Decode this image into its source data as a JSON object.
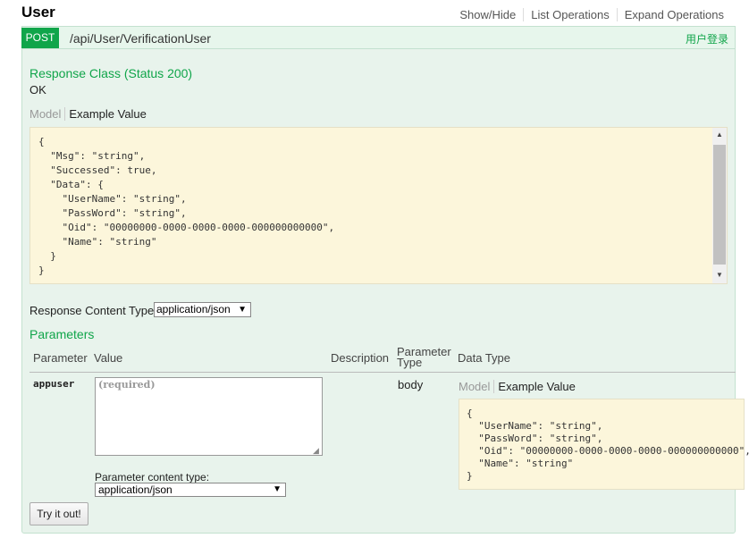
{
  "resource": {
    "title": "User",
    "links": [
      "Show/Hide",
      "List Operations",
      "Expand Operations"
    ]
  },
  "operation": {
    "method": "POST",
    "path": "/api/User/VerificationUser",
    "summary": "用户登录"
  },
  "response": {
    "class_title": "Response Class (Status 200)",
    "status_text": "OK",
    "tab_model": "Model",
    "tab_example": "Example Value",
    "example_json": "{\n  \"Msg\": \"string\",\n  \"Successed\": true,\n  \"Data\": {\n    \"UserName\": \"string\",\n    \"PassWord\": \"string\",\n    \"Oid\": \"00000000-0000-0000-0000-000000000000\",\n    \"Name\": \"string\"\n  }\n}",
    "content_type_label": "Response Content Type",
    "content_type_value": "application/json"
  },
  "parameters": {
    "title": "Parameters",
    "headers": {
      "parameter": "Parameter",
      "value": "Value",
      "description": "Description",
      "parameter_type_line1": "Parameter",
      "parameter_type_line2": "Type",
      "data_type": "Data Type"
    },
    "rows": [
      {
        "name": "appuser",
        "placeholder": "(required)",
        "param_type": "body",
        "tab_model": "Model",
        "tab_example": "Example Value",
        "example_json": "{\n  \"UserName\": \"string\",\n  \"PassWord\": \"string\",\n  \"Oid\": \"00000000-0000-0000-0000-000000000000\",\n  \"Name\": \"string\"\n}",
        "content_type_label": "Parameter content type:",
        "content_type_value": "application/json"
      }
    ]
  },
  "try_button": "Try it out!",
  "colors": {
    "post_green": "#10a54a",
    "block_bg": "#e8f3ec",
    "code_bg": "#fcf6db"
  }
}
